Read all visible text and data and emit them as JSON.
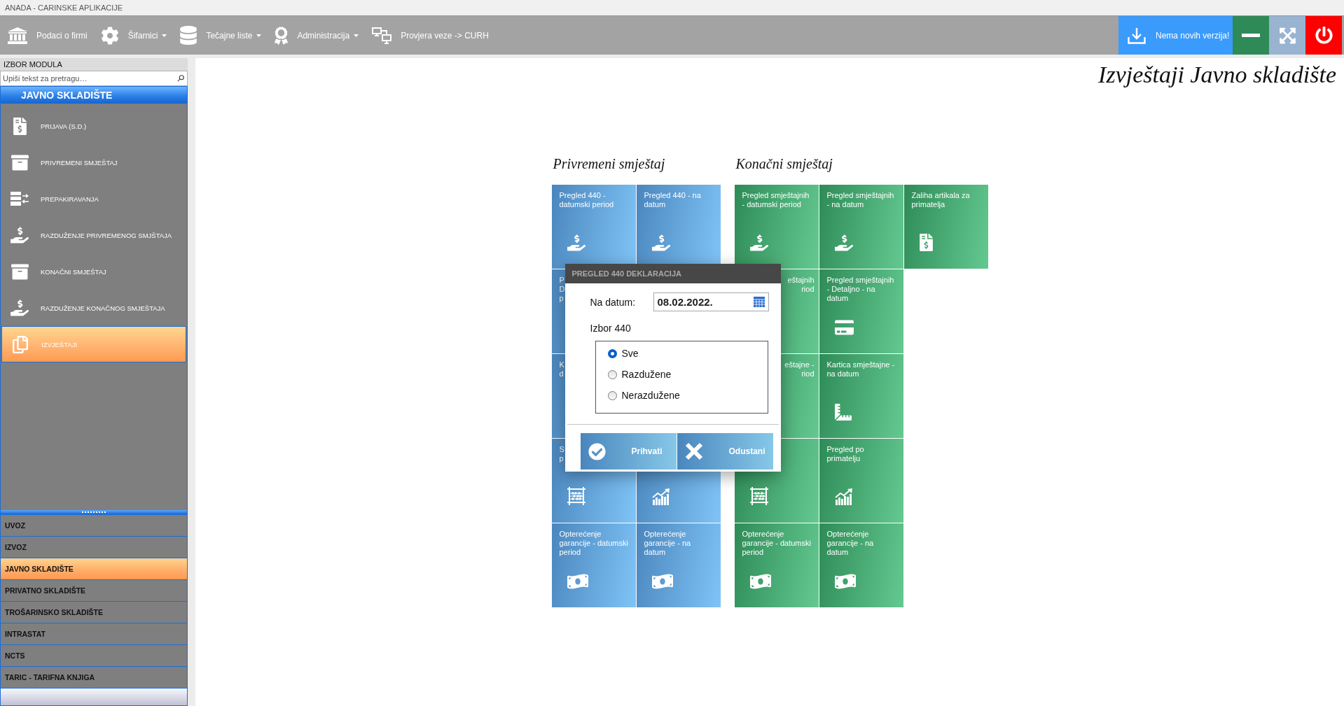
{
  "window": {
    "title": "ANADA - CARINSKE APLIKACIJE"
  },
  "toolbar": {
    "items": [
      {
        "kind": "company",
        "label": "Podaci o firmi",
        "dropdown": false
      },
      {
        "kind": "codebooks",
        "label": "Šifarnici",
        "dropdown": true
      },
      {
        "kind": "rates",
        "label": "Tečajne liste",
        "dropdown": true
      },
      {
        "kind": "admin",
        "label": "Administracija",
        "dropdown": true
      },
      {
        "kind": "connection",
        "label": "Provjera veze -> CURH",
        "dropdown": false
      }
    ],
    "buttons": [
      {
        "kind": "update",
        "label": "Nema novih verzija!",
        "color": "#3a9bfd"
      },
      {
        "kind": "minimize",
        "color": "#2e8b57"
      },
      {
        "kind": "fullscreen",
        "color": "#99b4d1"
      },
      {
        "kind": "exit",
        "color": "#ff0000"
      }
    ]
  },
  "sidebar": {
    "title": "IZBOR MODULA",
    "search": {
      "placeholder": "Upiši tekst za pretragu…"
    },
    "module_title": "JAVNO SKLADIŠTE",
    "items": [
      {
        "kind": "declaration",
        "label": "PRIJAVA (S.D.)",
        "selected": false
      },
      {
        "kind": "storage",
        "label": "PRIVREMENI SMJEŠTAJ",
        "selected": false
      },
      {
        "kind": "repack",
        "label": "PREPAKIRAVANJA",
        "selected": false
      },
      {
        "kind": "discharge",
        "label": "RAZDUŽENJE PRIVREMENOG SMJŠTAJA",
        "selected": false
      },
      {
        "kind": "storage",
        "label": "KONAČNI SMJEŠTAJ",
        "selected": false
      },
      {
        "kind": "discharge",
        "label": "RAZDUŽENJE KONAČNOG SMJEŠTAJA",
        "selected": false
      },
      {
        "kind": "reports",
        "label": "IZVJEŠTAJI",
        "selected": true
      }
    ],
    "modules": [
      {
        "label": "UVOZ",
        "selected": false
      },
      {
        "label": "IZVOZ",
        "selected": false
      },
      {
        "label": "JAVNO SKLADIŠTE",
        "selected": true
      },
      {
        "label": "PRIVATNO SKLADIŠTE",
        "selected": false
      },
      {
        "label": "TROŠARINSKO SKLADIŠTE",
        "selected": false
      },
      {
        "label": "INTRASTAT",
        "selected": false
      },
      {
        "label": "NCTS",
        "selected": false
      },
      {
        "label": "TARIC - TARIFNA KNJIGA",
        "selected": false
      }
    ]
  },
  "page": {
    "title": "Izvještaji Javno skladište",
    "tile_groups": [
      {
        "title": "Privremeni smještaj",
        "color": "#4a86bd",
        "rows": [
          [
            {
              "kind": "discharge",
              "label": "Pregled 440 - datumski period"
            },
            {
              "kind": "discharge",
              "label": "Pregled 440 - na datum"
            }
          ],
          [
            {
              "fragments": [
                "P",
                "D",
                "p"
              ],
              "covered_left": false
            },
            null
          ],
          [
            {
              "fragments": [
                "K",
                "d"
              ],
              "covered_left": false
            },
            null
          ],
          [
            {
              "kind": "tally",
              "fragments": [
                "S",
                "p"
              ],
              "covered_left": false
            },
            {
              "kind": "trend"
            }
          ],
          [
            {
              "kind": "guarantee",
              "label": "Opterećenje garancije - datumski period"
            },
            {
              "kind": "guarantee",
              "label": "Opterećenje garancije - na datum"
            }
          ]
        ]
      },
      {
        "title": "Konačni smještaj",
        "color": "#2e8b57",
        "rows": [
          [
            {
              "kind": "discharge",
              "label": "Pregled smještajnih - datumski period"
            },
            {
              "kind": "discharge",
              "label": "Pregled smještajnih - na datum"
            },
            {
              "kind": "stock",
              "label": "Zaliha artikala za primatelja"
            }
          ],
          [
            {
              "fragments": [
                "eštajnih",
                "riod"
              ],
              "covered_left": true
            },
            {
              "kind": "detail",
              "label": "Pregled smještajnih - Detaljno - na datum"
            }
          ],
          [
            {
              "fragments": [
                "eštajne -",
                "riod"
              ],
              "covered_left": true
            },
            {
              "kind": "card",
              "label": "Kartica smještajne - na datum"
            }
          ],
          [
            {
              "kind": "tally"
            },
            {
              "kind": "trend",
              "label": "Pregled po primatelju"
            }
          ],
          [
            {
              "kind": "guarantee",
              "label": "Opterećenje garancije - datumski period"
            },
            {
              "kind": "guarantee",
              "label": "Opterećenje garancije - na datum"
            }
          ]
        ]
      }
    ]
  },
  "dialog": {
    "title": "PREGLED 440 DEKLARACIJA",
    "date_label": "Na datum:",
    "date_value": "08.02.2022.",
    "choice_label": "Izbor 440",
    "options": [
      {
        "label": "Sve",
        "selected": true
      },
      {
        "label": "Razdužene",
        "selected": false
      },
      {
        "label": "Nerazdužene",
        "selected": false
      }
    ],
    "buttons": [
      {
        "kind": "accept",
        "label": "Prihvati"
      },
      {
        "kind": "cancel",
        "label": "Odustani"
      }
    ]
  }
}
